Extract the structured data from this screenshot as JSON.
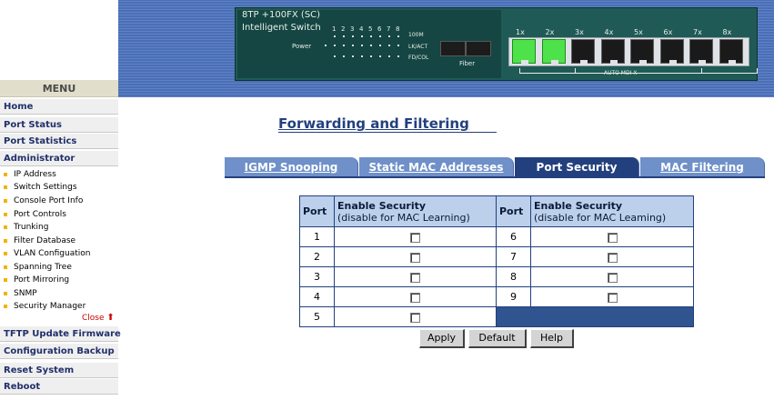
{
  "header": {
    "model_line": "8TP +100FX (SC)",
    "model_sub": "Intelligent Switch",
    "led_port_numbers": [
      "1",
      "2",
      "3",
      "4",
      "5",
      "6",
      "7",
      "8"
    ],
    "led_row_labels": [
      "100M",
      "LK/ACT",
      "FD/COL"
    ],
    "power_label": "Power",
    "fiber_label": "Fiber",
    "rj45_ports": [
      {
        "label": "1x",
        "link": true
      },
      {
        "label": "2x",
        "link": true
      },
      {
        "label": "3x",
        "link": false
      },
      {
        "label": "4x",
        "link": false
      },
      {
        "label": "5x",
        "link": false
      },
      {
        "label": "6x",
        "link": false
      },
      {
        "label": "7x",
        "link": false
      },
      {
        "label": "8x",
        "link": false
      }
    ],
    "auto_mdix_label": "AUTO MDI-X"
  },
  "sidebar": {
    "menu_title": "MENU",
    "items_top": [
      "Home",
      "Port Status",
      "Port Statistics",
      "Administrator"
    ],
    "admin_subitems": [
      "IP Address",
      "Switch Settings",
      "Console Port Info",
      "Port Controls",
      "Trunking",
      "Filter Database",
      "VLAN Configuation",
      "Spanning Tree",
      "Port Mirroring",
      "SNMP",
      "Security Manager"
    ],
    "close_label": "Close",
    "items_bottom": [
      "TFTP Update Firmware",
      "Configuration Backup",
      "Reset System",
      "Reboot"
    ]
  },
  "main": {
    "page_title": "Forwarding and Filtering",
    "tabs": [
      {
        "label": "IGMP Snooping",
        "active": false
      },
      {
        "label": "Static MAC Addresses",
        "active": false
      },
      {
        "label": "Port Security",
        "active": true
      },
      {
        "label": "MAC Filtering",
        "active": false
      }
    ],
    "table": {
      "col_port": "Port",
      "col_enable": "Enable Security",
      "left_sub": "(disable for MAC Learning)",
      "right_sub": "(disable for MAC Leaming)",
      "left_ports": [
        "1",
        "2",
        "3",
        "4",
        "5"
      ],
      "right_ports": [
        "6",
        "7",
        "8",
        "9"
      ]
    },
    "buttons": {
      "apply": "Apply",
      "default": "Default",
      "help": "Help"
    }
  },
  "colors": {
    "header_band": "#4a6fb8",
    "panel": "#1f5a56",
    "tab_inactive": "#6f90c8",
    "tab_active": "#23407e",
    "table_header": "#bcd0ec",
    "link_led": "#4ee24a"
  }
}
